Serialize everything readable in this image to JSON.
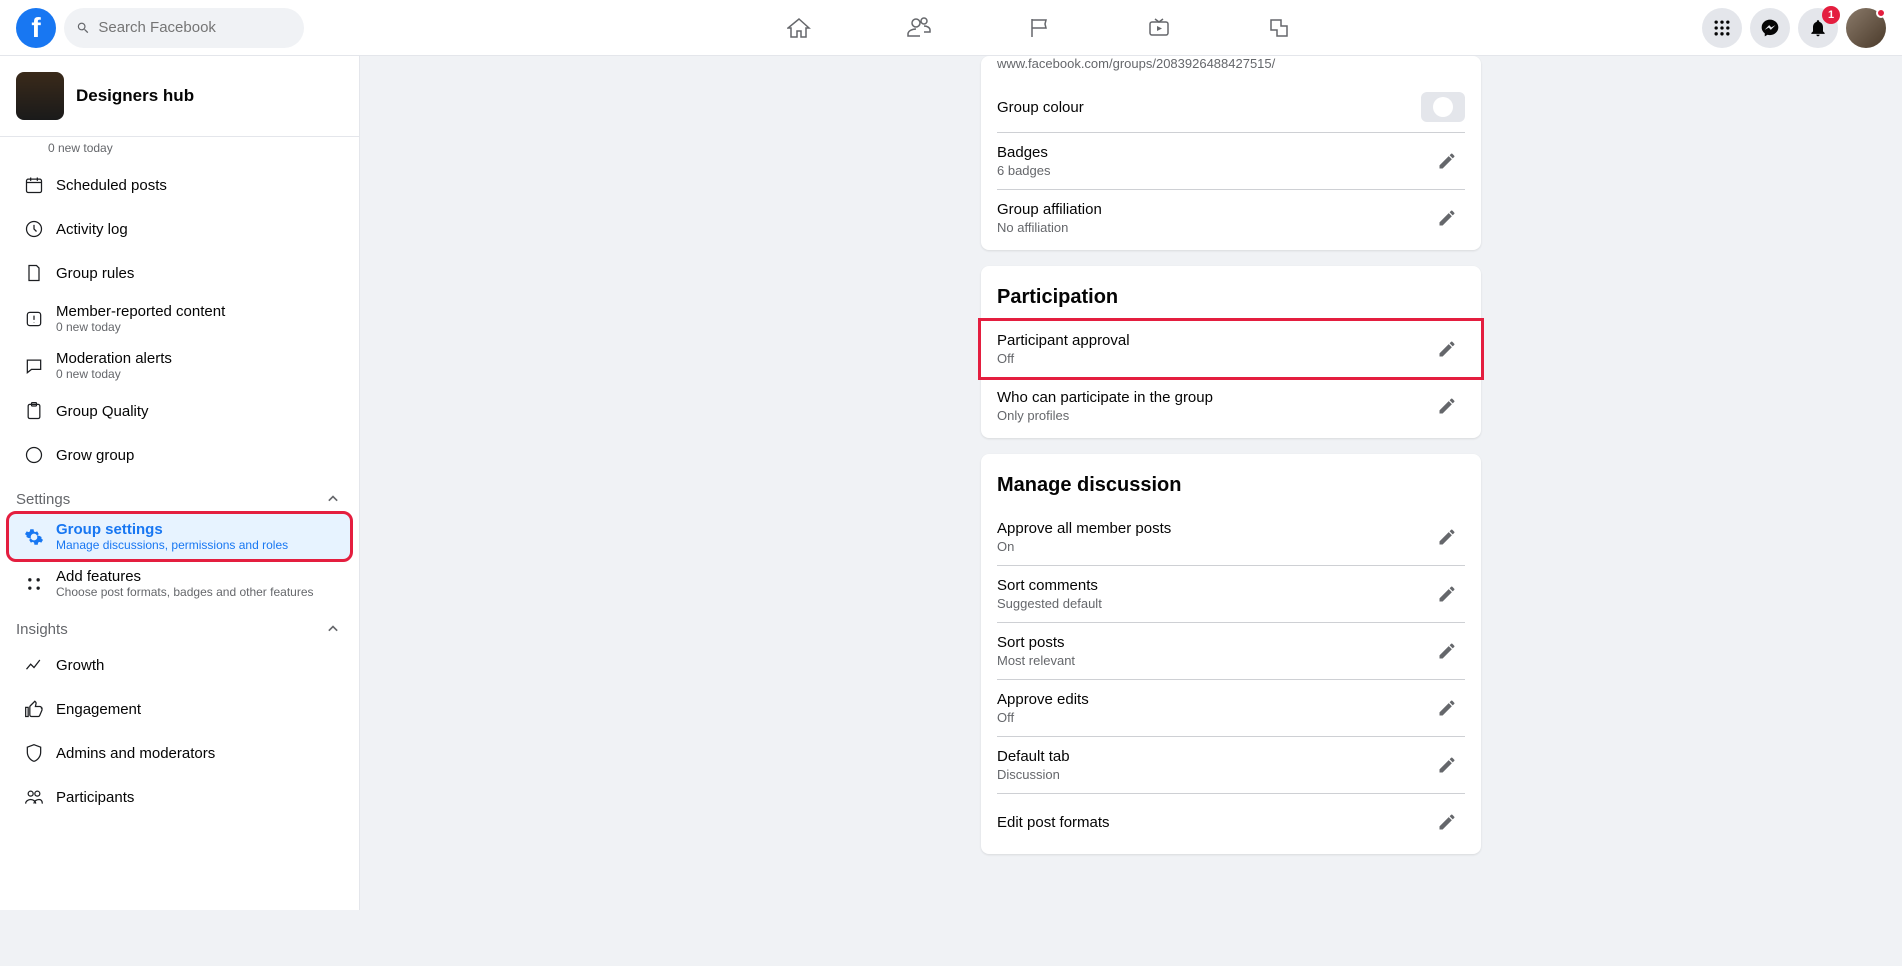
{
  "search": {
    "placeholder": "Search Facebook"
  },
  "notifications": {
    "count": "1"
  },
  "group": {
    "name": "Designers hub"
  },
  "sidebar": {
    "partial_top": "0 new today",
    "items": [
      {
        "label": "Scheduled posts",
        "sub": ""
      },
      {
        "label": "Activity log",
        "sub": ""
      },
      {
        "label": "Group rules",
        "sub": ""
      },
      {
        "label": "Member-reported content",
        "sub": "0 new today"
      },
      {
        "label": "Moderation alerts",
        "sub": "0 new today"
      },
      {
        "label": "Group Quality",
        "sub": ""
      },
      {
        "label": "Grow group",
        "sub": ""
      }
    ],
    "sections": {
      "settings": {
        "title": "Settings",
        "items": [
          {
            "label": "Group settings",
            "sub": "Manage discussions, permissions and roles"
          },
          {
            "label": "Add features",
            "sub": "Choose post formats, badges and other features"
          }
        ]
      },
      "insights": {
        "title": "Insights",
        "items": [
          {
            "label": "Growth"
          },
          {
            "label": "Engagement"
          },
          {
            "label": "Admins and moderators"
          },
          {
            "label": "Participants"
          }
        ]
      }
    }
  },
  "main": {
    "url_partial": "www.facebook.com/groups/2083926488427515/",
    "group_colour_label": "Group colour",
    "badges": {
      "label": "Badges",
      "value": "6 badges"
    },
    "affiliation": {
      "label": "Group affiliation",
      "value": "No affiliation"
    },
    "participation": {
      "title": "Participation",
      "approval": {
        "label": "Participant approval",
        "value": "Off"
      },
      "who": {
        "label": "Who can participate in the group",
        "value": "Only profiles"
      }
    },
    "discussion": {
      "title": "Manage discussion",
      "approve": {
        "label": "Approve all member posts",
        "value": "On"
      },
      "sort_comments": {
        "label": "Sort comments",
        "value": "Suggested default"
      },
      "sort_posts": {
        "label": "Sort posts",
        "value": "Most relevant"
      },
      "approve_edits": {
        "label": "Approve edits",
        "value": "Off"
      },
      "default_tab": {
        "label": "Default tab",
        "value": "Discussion"
      },
      "edit_formats": {
        "label": "Edit post formats",
        "value": ""
      }
    }
  }
}
